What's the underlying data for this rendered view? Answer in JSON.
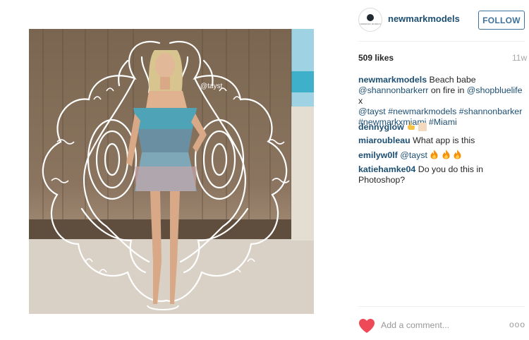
{
  "post": {
    "username": "newmarkmodels",
    "avatar_text": "NEWMARK MODELS",
    "follow_label": "FOLLOW",
    "likes": "509 likes",
    "time_ago": "11w",
    "photo_watermark": "@tayst",
    "caption": {
      "user": "newmarkmodels",
      "text1": " Beach babe ",
      "mention1": "@shannonbarkerr",
      "text2": " on fire in ",
      "mention2": "@shopbluelife",
      "text3": " x ",
      "mention3": "@tayst",
      "text4": " ",
      "tag1": "#newmarkmodels",
      "text5": " ",
      "tag2": "#shannonbarker",
      "text6": " ",
      "tag3": "#newmarkxmiami",
      "text7": " ",
      "tag4": "#Miami"
    },
    "comments": [
      {
        "user": "dennyglow",
        "text": ""
      },
      {
        "user": "miaroubleau",
        "text": "What app is this"
      },
      {
        "user": "emilyw0lf",
        "mention": "@tayst",
        "text": ""
      },
      {
        "user": "katiehamke04",
        "text": "Do you do this in Photoshop?"
      }
    ],
    "add_comment_placeholder": "Add a comment...",
    "more_label": "ooo"
  },
  "colors": {
    "link": "#1d4f73",
    "follow": "#3f729b",
    "heart": "#ed4956",
    "muted": "#999999"
  },
  "icons": [
    "heart-icon",
    "ok-hand-emoji-icon",
    "fire-emoji-icon",
    "more-options-icon"
  ]
}
